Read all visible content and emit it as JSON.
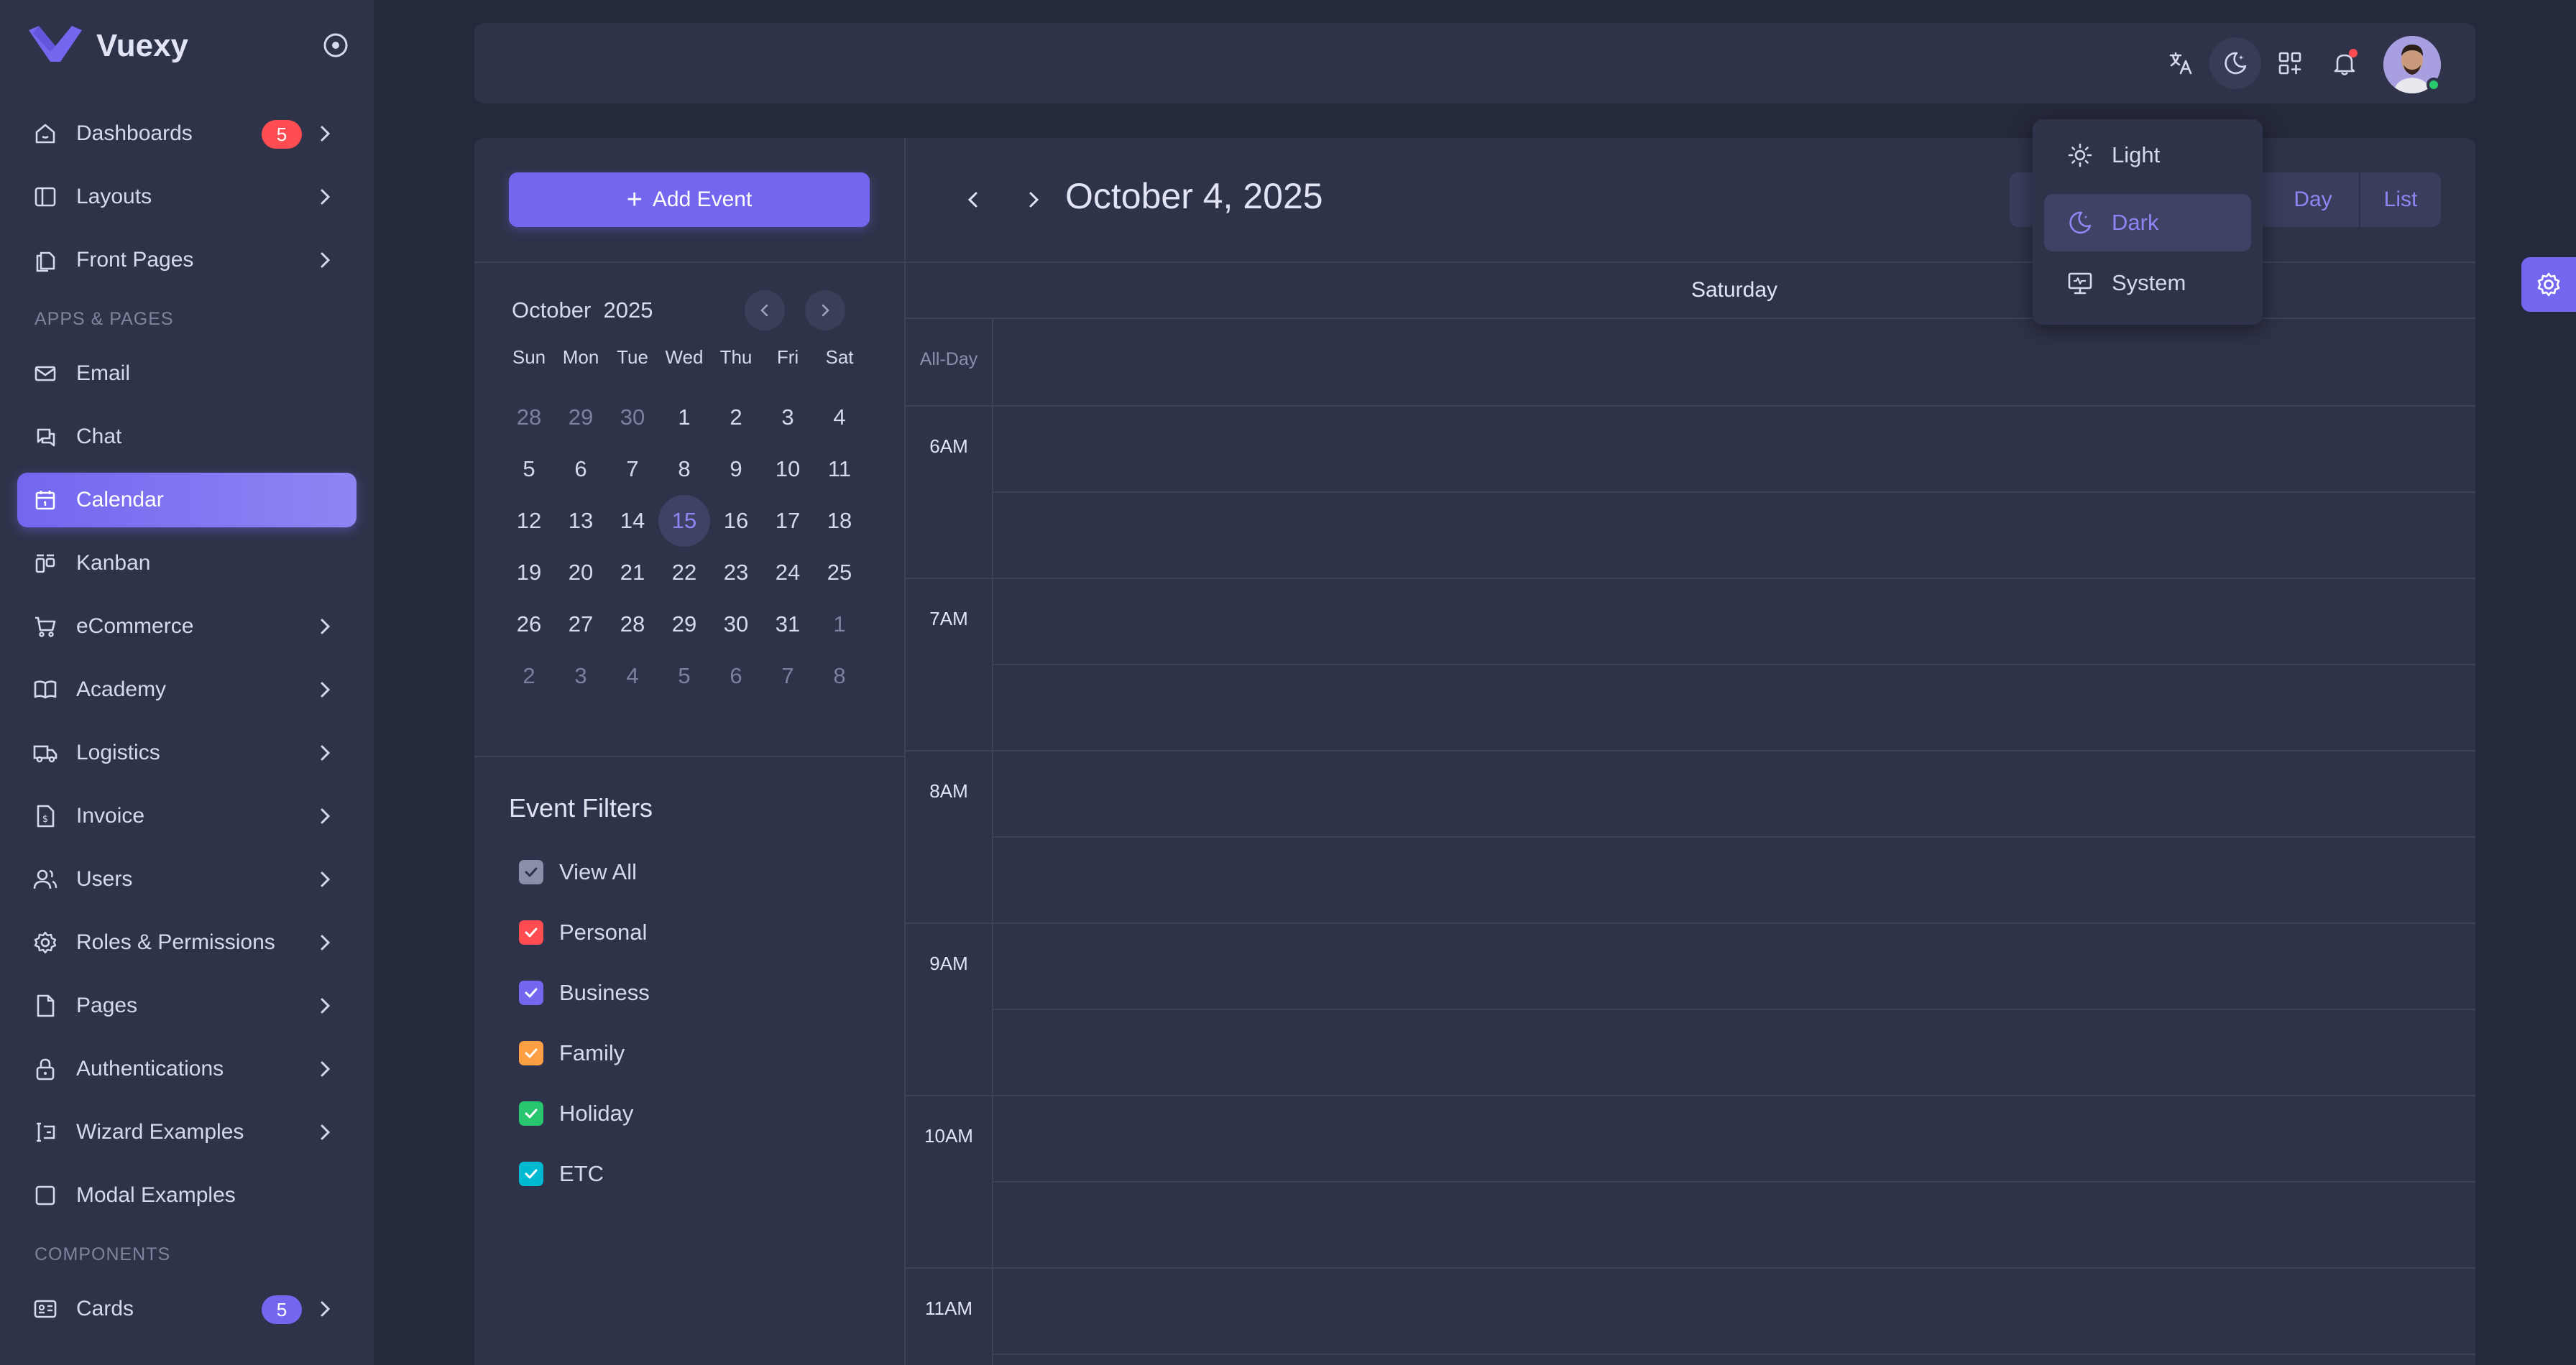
{
  "brand": {
    "name": "Vuexy"
  },
  "sidebar": {
    "items": [
      {
        "label": "Dashboards",
        "icon": "smart-home-icon",
        "badge": "5",
        "has_children": true
      },
      {
        "label": "Layouts",
        "icon": "layout-sidebar-icon",
        "has_children": true
      },
      {
        "label": "Front Pages",
        "icon": "files-icon",
        "has_children": true
      }
    ],
    "section_apps": "APPS & PAGES",
    "apps": [
      {
        "label": "Email",
        "icon": "mail-icon"
      },
      {
        "label": "Chat",
        "icon": "messages-icon"
      },
      {
        "label": "Calendar",
        "icon": "calendar-icon",
        "active": true
      },
      {
        "label": "Kanban",
        "icon": "layout-kanban-icon"
      },
      {
        "label": "eCommerce",
        "icon": "shopping-cart-icon",
        "has_children": true
      },
      {
        "label": "Academy",
        "icon": "book-icon",
        "has_children": true
      },
      {
        "label": "Logistics",
        "icon": "truck-icon",
        "has_children": true
      },
      {
        "label": "Invoice",
        "icon": "file-dollar-icon",
        "has_children": true
      },
      {
        "label": "Users",
        "icon": "users-icon",
        "has_children": true
      },
      {
        "label": "Roles & Permissions",
        "icon": "settings-icon",
        "has_children": true
      },
      {
        "label": "Pages",
        "icon": "file-icon",
        "has_children": true
      },
      {
        "label": "Authentications",
        "icon": "lock-icon",
        "has_children": true
      },
      {
        "label": "Wizard Examples",
        "icon": "forms-icon",
        "has_children": true
      },
      {
        "label": "Modal Examples",
        "icon": "square-icon"
      }
    ],
    "section_components": "COMPONENTS",
    "components": [
      {
        "label": "Cards",
        "icon": "id-card-icon",
        "badge": "5",
        "has_children": true
      }
    ]
  },
  "calendar": {
    "add_event_label": "Add Event",
    "title": "October 4, 2025",
    "view_buttons": [
      "Day",
      "List"
    ],
    "day_header": "Saturday",
    "all_day_label": "All-Day",
    "time_labels": [
      "6AM",
      "7AM",
      "8AM",
      "9AM",
      "10AM",
      "11AM"
    ]
  },
  "mini_calendar": {
    "month": "October",
    "year": "2025",
    "weekdays": [
      "Sun",
      "Mon",
      "Tue",
      "Wed",
      "Thu",
      "Fri",
      "Sat"
    ],
    "weeks": [
      [
        "28",
        "29",
        "30",
        "1",
        "2",
        "3",
        "4"
      ],
      [
        "5",
        "6",
        "7",
        "8",
        "9",
        "10",
        "11"
      ],
      [
        "12",
        "13",
        "14",
        "15",
        "16",
        "17",
        "18"
      ],
      [
        "19",
        "20",
        "21",
        "22",
        "23",
        "24",
        "25"
      ],
      [
        "26",
        "27",
        "28",
        "29",
        "30",
        "31",
        "1"
      ],
      [
        "2",
        "3",
        "4",
        "5",
        "6",
        "7",
        "8"
      ]
    ],
    "today": "15"
  },
  "filters": {
    "title": "Event Filters",
    "items": [
      {
        "label": "View All",
        "color": "#8a8fa8",
        "checked": true
      },
      {
        "label": "Personal",
        "color": "#ff4c51",
        "checked": true
      },
      {
        "label": "Business",
        "color": "#7367f0",
        "checked": true
      },
      {
        "label": "Family",
        "color": "#ff9f43",
        "checked": true
      },
      {
        "label": "Holiday",
        "color": "#28c76f",
        "checked": true
      },
      {
        "label": "ETC",
        "color": "#00bad1",
        "checked": true
      }
    ]
  },
  "theme_menu": {
    "options": [
      {
        "label": "Light",
        "icon": "sun-icon"
      },
      {
        "label": "Dark",
        "icon": "moon-icon",
        "selected": true
      },
      {
        "label": "System",
        "icon": "device-desktop-icon"
      }
    ]
  },
  "colors": {
    "primary": "#7367f0",
    "danger": "#ff4c51",
    "success": "#28c76f",
    "sidebar_bg": "#2f3349",
    "page_bg": "#25293c"
  }
}
